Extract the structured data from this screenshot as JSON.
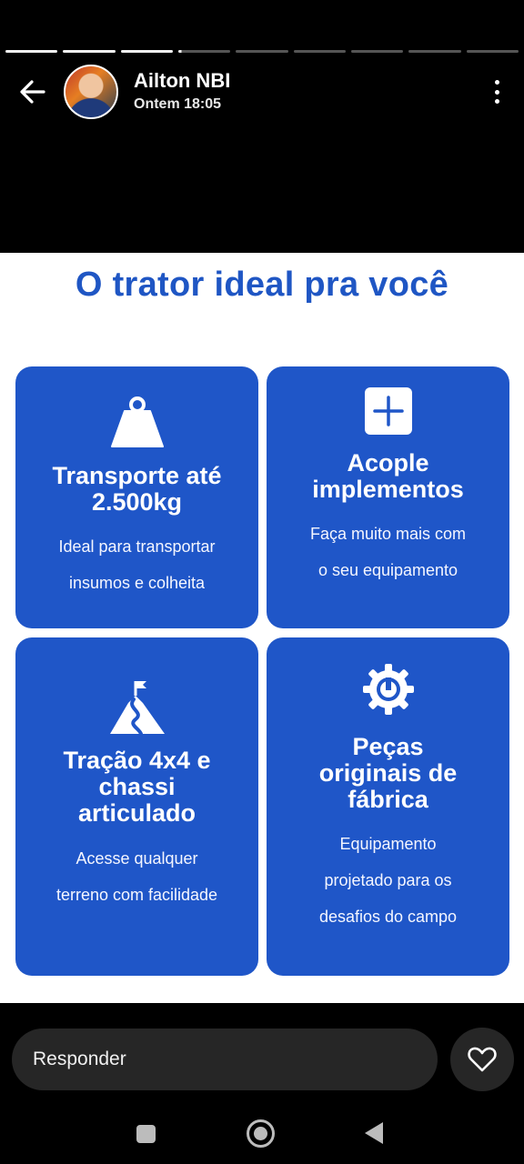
{
  "story": {
    "segments_total": 9,
    "segments_done": 3,
    "current_segment_progress": 0.06
  },
  "header": {
    "username": "Ailton NBI",
    "timestamp": "Ontem 18:05",
    "back_icon": "arrow-left-icon",
    "menu_icon": "more-vertical-icon"
  },
  "content": {
    "headline": "O trator ideal pra você",
    "cards": [
      {
        "title_lines": [
          "Transporte até",
          "2.500kg"
        ],
        "desc_lines": [
          "Ideal para transportar",
          "insumos e colheita"
        ],
        "icon": "weight-icon"
      },
      {
        "title_lines": [
          "Acople",
          "implementos"
        ],
        "desc_lines": [
          "Faça muito mais com",
          "o seu equipamento"
        ],
        "icon": "plus-square-icon"
      },
      {
        "title_lines": [
          "Tração 4x4 e",
          "chassi",
          "articulado"
        ],
        "desc_lines": [
          "Acesse qualquer",
          "terreno com facilidade"
        ],
        "icon": "mountain-flag-icon"
      },
      {
        "title_lines": [
          "Peças",
          "originais de",
          "fábrica"
        ],
        "desc_lines": [
          "Equipamento",
          "projetado para os",
          "desafios do campo"
        ],
        "icon": "gear-icon"
      }
    ],
    "colors": {
      "card": "#1f56c8",
      "headline": "#1f56c4",
      "background": "#ffffff"
    }
  },
  "footer": {
    "reply_placeholder": "Responder",
    "like_icon": "heart-icon"
  },
  "navbar": {
    "icons": [
      "recents-square-icon",
      "home-circle-icon",
      "back-triangle-icon"
    ]
  }
}
